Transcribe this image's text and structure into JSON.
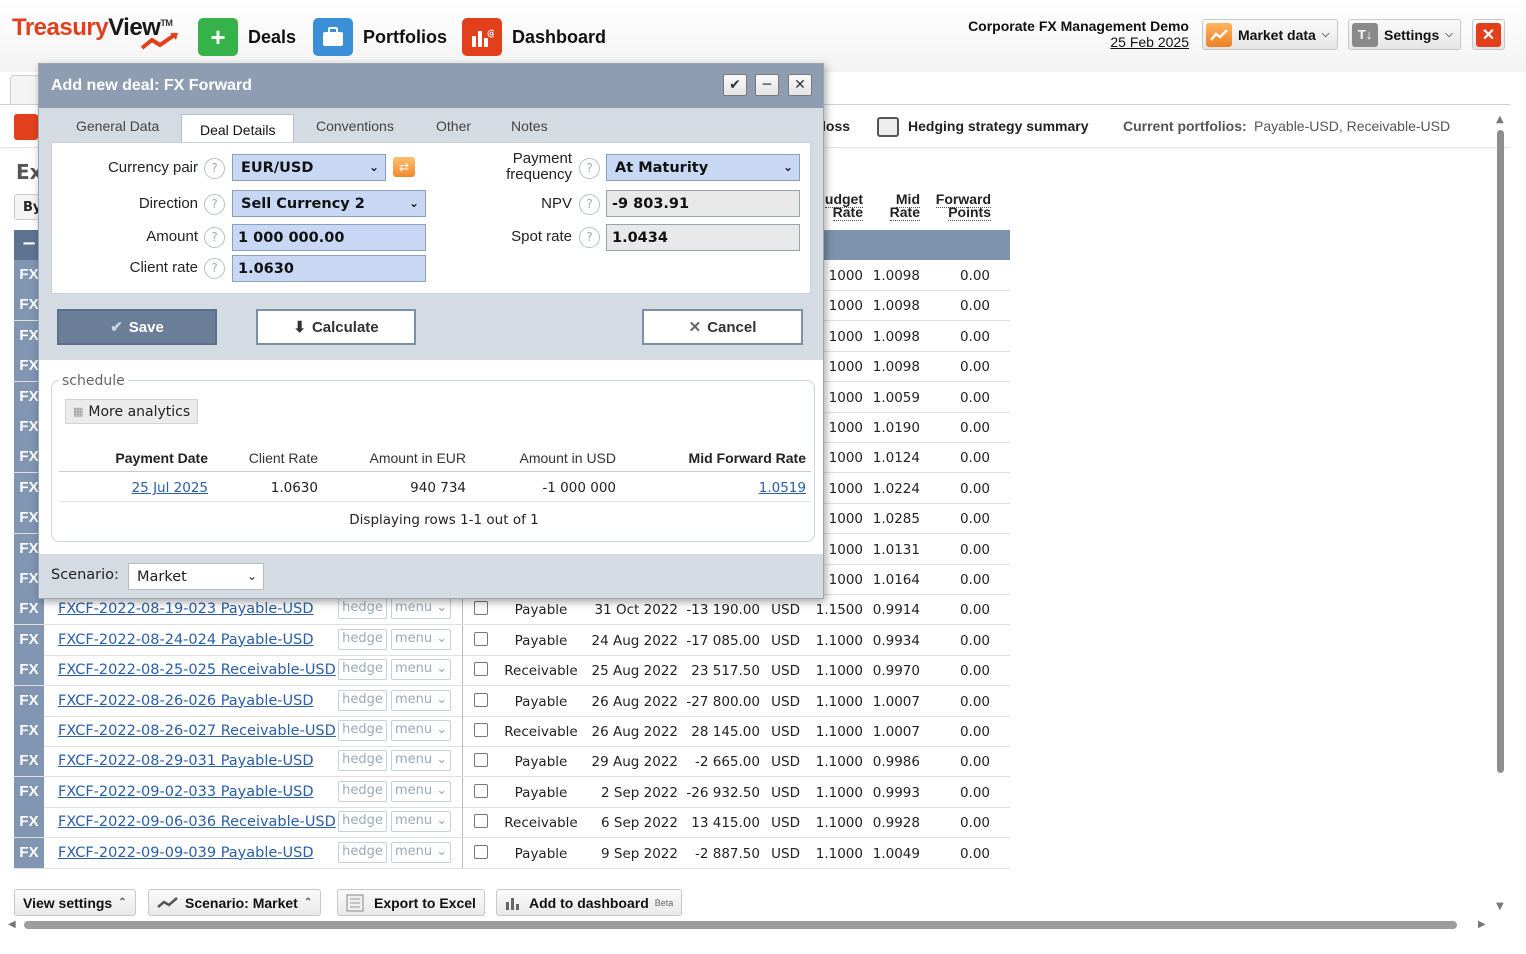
{
  "header": {
    "logo_part1": "Treasury",
    "logo_part2": "View",
    "logo_tm": "TM",
    "nav": [
      {
        "label": "Deals",
        "icon": "plus-icon",
        "color": "#35b34a"
      },
      {
        "label": "Portfolios",
        "icon": "briefcase-icon",
        "color": "#3b8fd6"
      },
      {
        "label": "Dashboard",
        "icon": "chart-icon",
        "color": "#e2401c"
      }
    ],
    "company": "Corporate FX Management Demo",
    "date": "25 Feb 2025",
    "market_data_label": "Market data",
    "settings_label": "Settings"
  },
  "subbar": {
    "loss_fragment": "loss",
    "hedging_summary_label": "Hedging strategy summary",
    "current_portfolios_label": "Current portfolios:",
    "current_portfolios_value": "Payable-USD, Receivable-USD"
  },
  "grid": {
    "page_title_fragment": "Ex",
    "by_fragment": "By",
    "collapse_symbol": "−",
    "col_budget_rate": [
      "udget",
      "Rate"
    ],
    "col_mid_rate": [
      "Mid",
      "Rate"
    ],
    "col_forward_points": [
      "Forward",
      "Points"
    ],
    "hidden_rows": [
      {
        "budget": "1000",
        "mid": "1.0098",
        "fwd": "0.00"
      },
      {
        "budget": "1000",
        "mid": "1.0098",
        "fwd": "0.00"
      },
      {
        "budget": "1000",
        "mid": "1.0098",
        "fwd": "0.00"
      },
      {
        "budget": "1000",
        "mid": "1.0098",
        "fwd": "0.00"
      },
      {
        "budget": "1000",
        "mid": "1.0059",
        "fwd": "0.00"
      },
      {
        "budget": "1000",
        "mid": "1.0190",
        "fwd": "0.00"
      },
      {
        "budget": "1000",
        "mid": "1.0124",
        "fwd": "0.00"
      },
      {
        "budget": "1000",
        "mid": "1.0224",
        "fwd": "0.00"
      },
      {
        "budget": "1000",
        "mid": "1.0285",
        "fwd": "0.00"
      },
      {
        "budget": "1000",
        "mid": "1.0131",
        "fwd": "0.00"
      },
      {
        "budget": "1000",
        "mid": "1.0164",
        "fwd": "0.00"
      }
    ],
    "rows": [
      {
        "name": "FXCF-2022-08-19-023 Payable-USD",
        "type": "Payable",
        "date": "31 Oct 2022",
        "amount": "-13 190.00",
        "ccy": "USD",
        "budget": "1.1500",
        "mid": "0.9914",
        "fwd": "0.00"
      },
      {
        "name": "FXCF-2022-08-24-024 Payable-USD",
        "type": "Payable",
        "date": "24 Aug 2022",
        "amount": "-17 085.00",
        "ccy": "USD",
        "budget": "1.1000",
        "mid": "0.9934",
        "fwd": "0.00"
      },
      {
        "name": "FXCF-2022-08-25-025 Receivable-USD",
        "type": "Receivable",
        "date": "25 Aug 2022",
        "amount": "23 517.50",
        "ccy": "USD",
        "budget": "1.1000",
        "mid": "0.9970",
        "fwd": "0.00"
      },
      {
        "name": "FXCF-2022-08-26-026 Payable-USD",
        "type": "Payable",
        "date": "26 Aug 2022",
        "amount": "-27 800.00",
        "ccy": "USD",
        "budget": "1.1000",
        "mid": "1.0007",
        "fwd": "0.00"
      },
      {
        "name": "FXCF-2022-08-26-027 Receivable-USD",
        "type": "Receivable",
        "date": "26 Aug 2022",
        "amount": "28 145.00",
        "ccy": "USD",
        "budget": "1.1000",
        "mid": "1.0007",
        "fwd": "0.00"
      },
      {
        "name": "FXCF-2022-08-29-031 Payable-USD",
        "type": "Payable",
        "date": "29 Aug 2022",
        "amount": "-2 665.00",
        "ccy": "USD",
        "budget": "1.1000",
        "mid": "0.9986",
        "fwd": "0.00"
      },
      {
        "name": "FXCF-2022-09-02-033 Payable-USD",
        "type": "Payable",
        "date": "2 Sep 2022",
        "amount": "-26 932.50",
        "ccy": "USD",
        "budget": "1.1000",
        "mid": "0.9993",
        "fwd": "0.00"
      },
      {
        "name": "FXCF-2022-09-06-036 Receivable-USD",
        "type": "Receivable",
        "date": "6 Sep 2022",
        "amount": "13 415.00",
        "ccy": "USD",
        "budget": "1.1000",
        "mid": "0.9928",
        "fwd": "0.00"
      },
      {
        "name": "FXCF-2022-09-09-039 Payable-USD",
        "type": "Payable",
        "date": "9 Sep 2022",
        "amount": "-2 887.50",
        "ccy": "USD",
        "budget": "1.1000",
        "mid": "1.0049",
        "fwd": "0.00"
      }
    ],
    "fx_label": "FX",
    "hedge_label": "hedge",
    "menu_label": "menu"
  },
  "footer": {
    "view_settings_label": "View settings",
    "scenario_label": "Scenario: Market",
    "export_label": "Export to Excel",
    "add_dashboard_label": "Add to dashboard",
    "beta_label": "Beta"
  },
  "dialog": {
    "title": "Add new deal: FX Forward",
    "tabs": [
      "General Data",
      "Deal Details",
      "Conventions",
      "Other",
      "Notes"
    ],
    "active_tab": "Deal Details",
    "currency_pair_label": "Currency pair",
    "currency_pair_value": "EUR/USD",
    "direction_label": "Direction",
    "direction_value": "Sell Currency 2",
    "amount_label": "Amount",
    "amount_value": "1 000 000.00",
    "client_rate_label": "Client rate",
    "client_rate_value": "1.0630",
    "payment_frequency_label_1": "Payment",
    "payment_frequency_label_2": "frequency",
    "payment_frequency_value": "At Maturity",
    "npv_label": "NPV",
    "npv_value": "-9 803.91",
    "spot_rate_label": "Spot rate",
    "spot_rate_value": "1.0434",
    "save_label": "Save",
    "calculate_label": "Calculate",
    "cancel_label": "Cancel",
    "schedule_legend": "schedule",
    "more_analytics_label": "More analytics",
    "schedule_headers": [
      "Payment Date",
      "Client Rate",
      "Amount in EUR",
      "Amount in USD",
      "Mid Forward Rate"
    ],
    "schedule_rows": [
      {
        "payment_date": "25 Jul 2025",
        "client_rate": "1.0630",
        "amount_eur": "940 734",
        "amount_usd": "-1 000 000",
        "mid_forward_rate": "1.0519"
      }
    ],
    "schedule_footer": "Displaying rows 1-1 out of 1",
    "scenario_label": "Scenario:",
    "scenario_value": "Market",
    "help_symbol": "?"
  }
}
